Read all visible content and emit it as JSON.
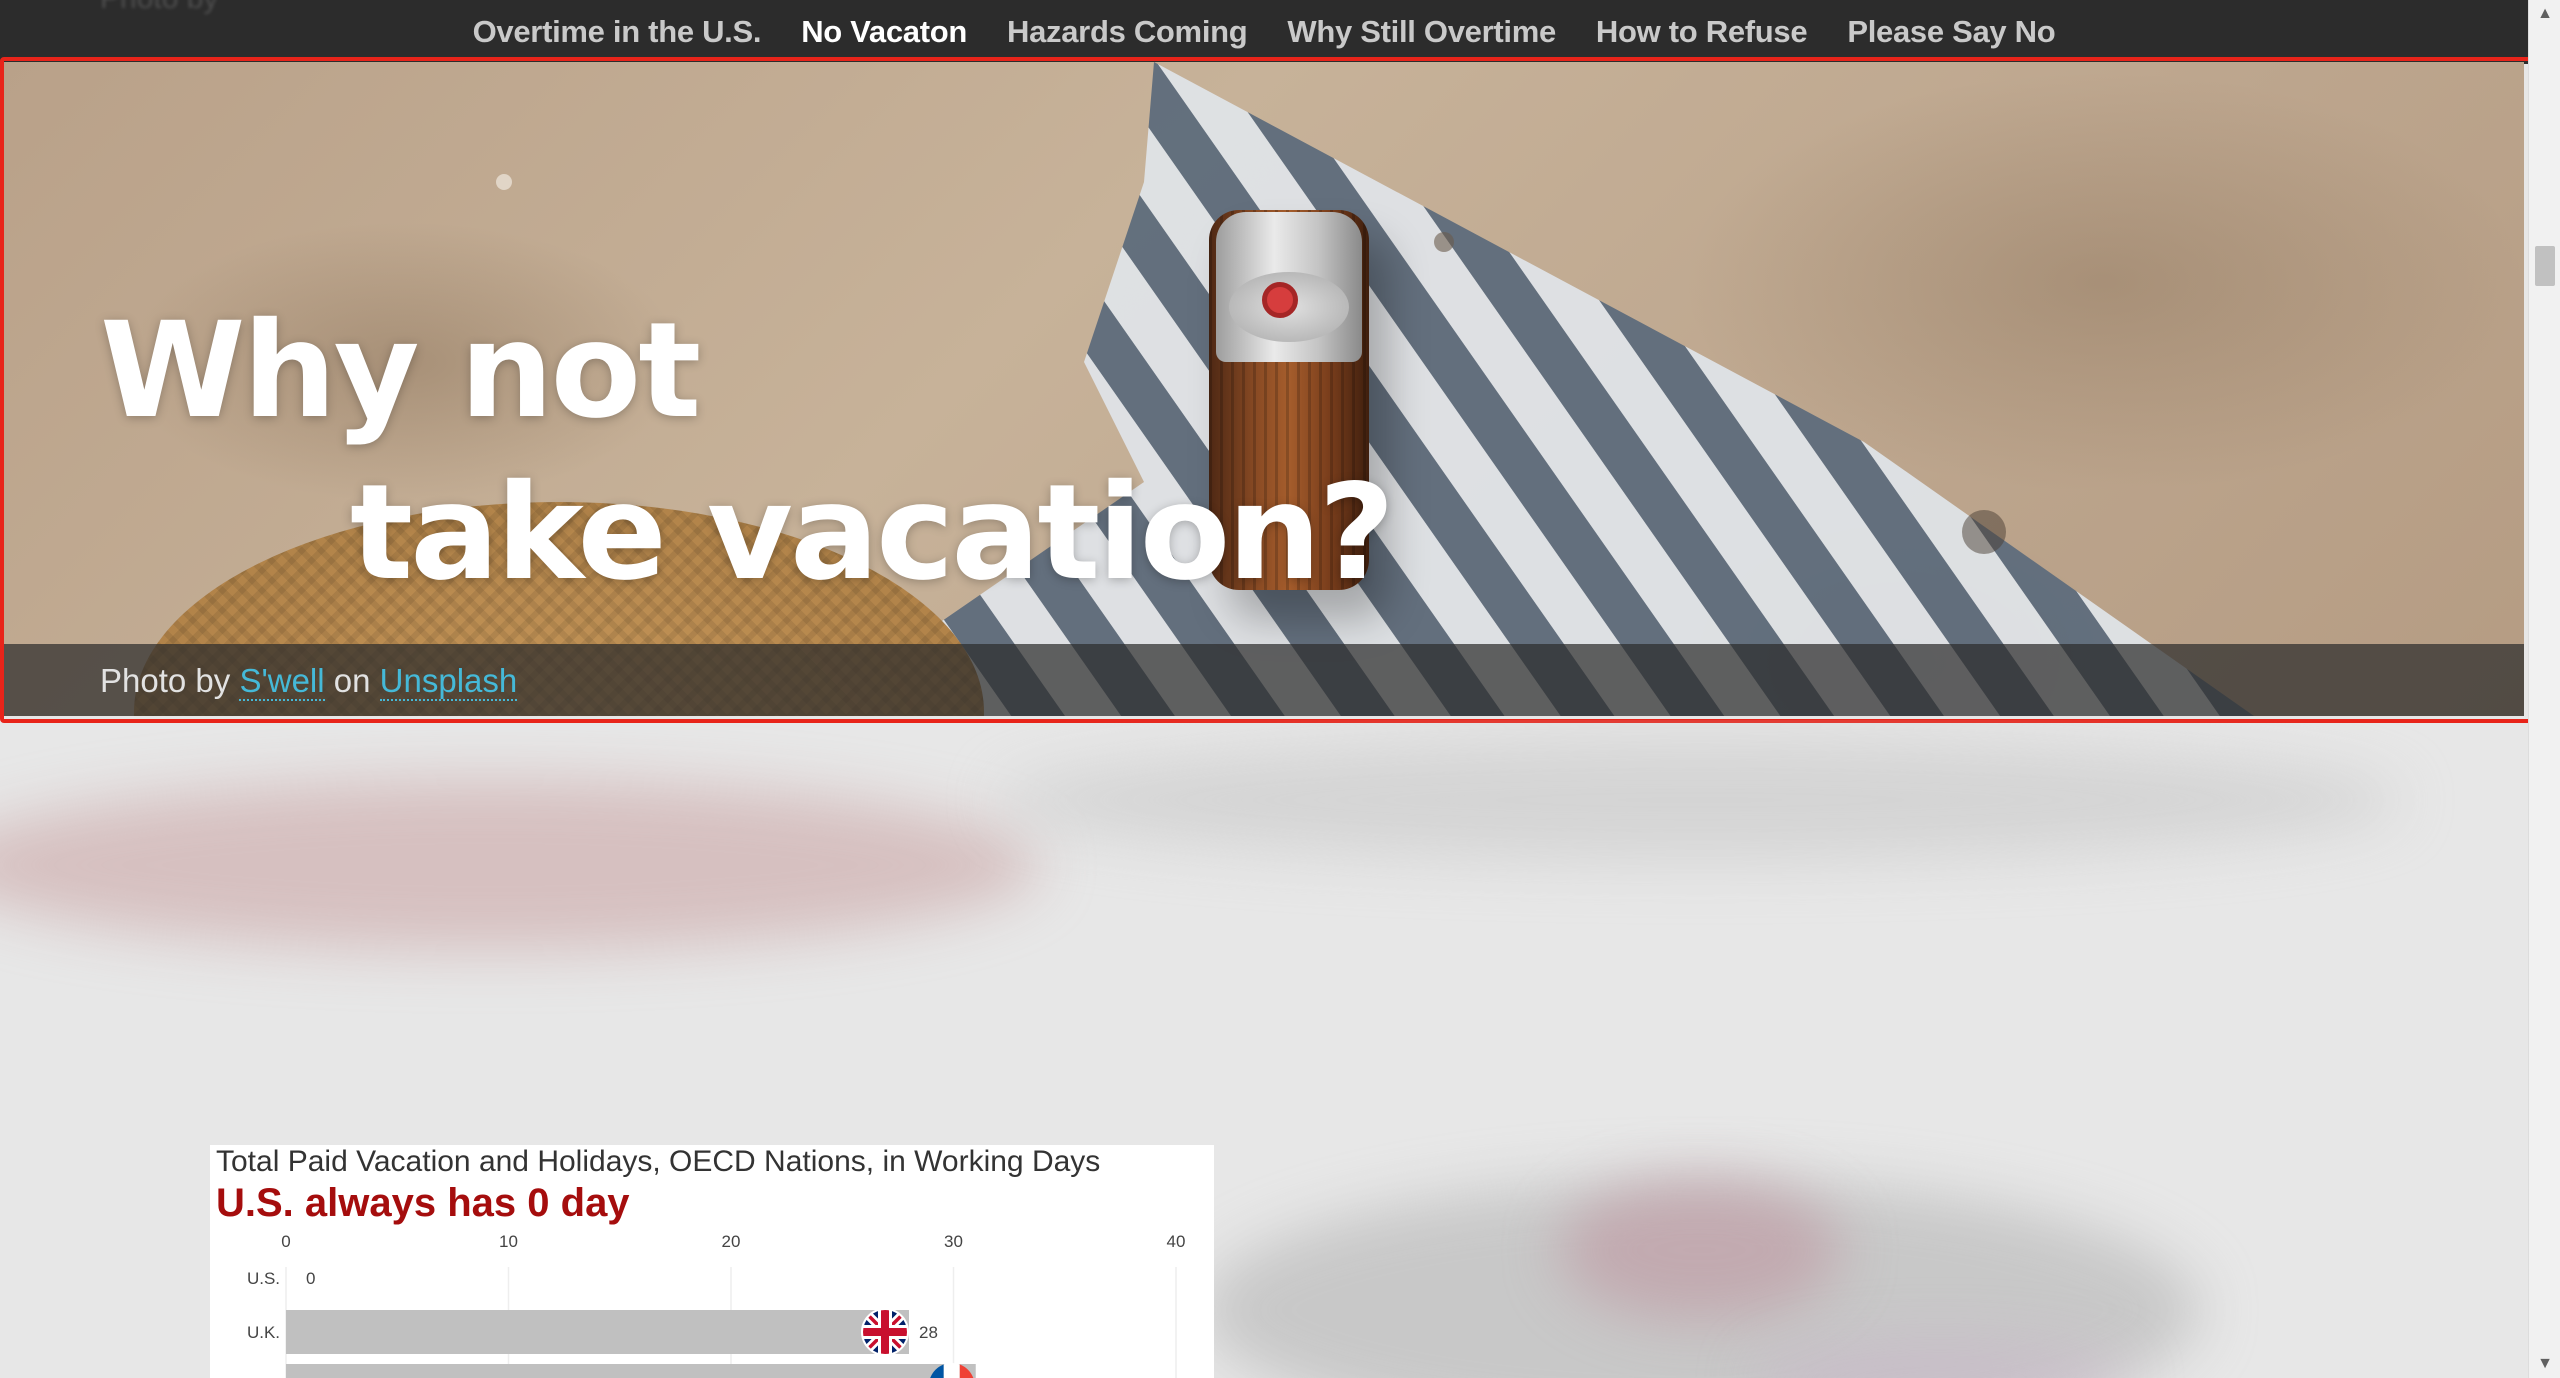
{
  "nav": {
    "ghost_text": "Photo by",
    "items": [
      {
        "label": "Overtime in the U.S."
      },
      {
        "label": "No Vacaton"
      },
      {
        "label": "Hazards Coming"
      },
      {
        "label": "Why Still Overtime"
      },
      {
        "label": "How to Refuse"
      },
      {
        "label": "Please Say No"
      }
    ],
    "active_index": 1
  },
  "hero": {
    "title_line1": "Why not",
    "title_line2": "take vacation?",
    "credit_prefix": "Photo by",
    "credit_author": "S'well",
    "credit_mid": "on",
    "credit_source": "Unsplash"
  },
  "colors": {
    "accent_red": "#a50d0d",
    "link": "#45b9d8",
    "highlight_outline": "#e8241a",
    "bar": "#c0c0c0"
  },
  "chart_data": {
    "type": "bar",
    "orientation": "horizontal",
    "subtitle": "Total Paid Vacation and Holidays, OECD Nations, in Working Days",
    "title": "U.S. always has 0 day",
    "ticks": [
      0,
      10,
      20,
      30,
      40
    ],
    "xlim": [
      0,
      40
    ],
    "categories": [
      "U.S.",
      "U.K.",
      ""
    ],
    "values": [
      0,
      28,
      31
    ],
    "value_labels": [
      "0",
      "28",
      ""
    ],
    "flags": [
      "",
      "uk-flag-icon",
      "france-flag-icon"
    ]
  }
}
